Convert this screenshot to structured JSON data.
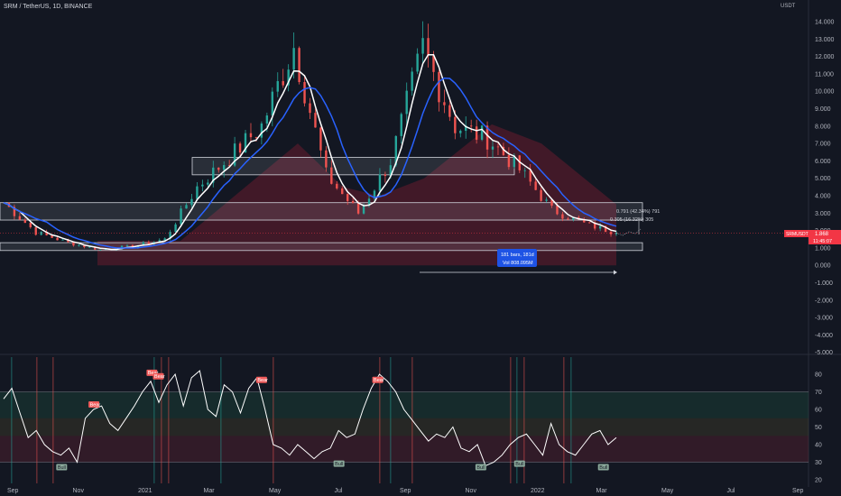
{
  "header": {
    "symbol_line": "SRM / TetherUS, 1D, BINANCE"
  },
  "colors": {
    "background": "#131722",
    "candle_up": "#26a69a",
    "candle_down": "#ef5350",
    "ma_fast": "#ffffff",
    "ma_slow": "#2962ff",
    "rsi_line": "#ffffff",
    "zone_box": "#d1d4dc",
    "label_bg": "#2962ff",
    "price_label_bg": "#f23645"
  },
  "chart_data": [
    {
      "type": "line",
      "title": "SRM / TetherUS, 1D, BINANCE",
      "currency": "USDT",
      "y_ticks": [
        "14.000",
        "13.000",
        "12.000",
        "11.000",
        "10.000",
        "9.000",
        "8.000",
        "7.000",
        "6.000",
        "5.000",
        "4.000",
        "3.000",
        "2.000",
        "1.000",
        "0.000",
        "-1.000",
        "-2.000",
        "-3.000",
        "-4.000",
        "-5.000"
      ],
      "ylim": [
        -5.3,
        14.3
      ],
      "x_ticks": [
        "Sep",
        "Nov",
        "2021",
        "Mar",
        "May",
        "Jul",
        "Sep",
        "Nov",
        "2022",
        "Mar",
        "May",
        "Jul",
        "Sep"
      ],
      "series": [
        {
          "name": "price",
          "x": [
            "2020-08",
            "2020-09",
            "2020-10",
            "2020-11",
            "2020-12",
            "2021-01",
            "2021-02",
            "2021-03",
            "2021-04",
            "2021-05",
            "2021-06",
            "2021-07",
            "2021-08",
            "2021-09",
            "2021-10",
            "2021-11",
            "2021-12",
            "2022-01",
            "2022-02",
            "2022-03"
          ],
          "values": [
            3.6,
            1.9,
            1.3,
            0.9,
            1.1,
            1.5,
            4.5,
            6.2,
            8.0,
            12.6,
            5.2,
            3.0,
            6.0,
            12.5,
            8.0,
            7.3,
            5.5,
            3.2,
            2.4,
            1.86
          ]
        }
      ],
      "zones": [
        {
          "from": 5.2,
          "to": 6.2
        },
        {
          "from": 2.6,
          "to": 3.6
        },
        {
          "from": 0.85,
          "to": 1.3
        }
      ],
      "annotations": {
        "measure_top": "0.791 (42.34%) 791",
        "measure_bottom": "0.305 (16.32%) 305",
        "range_bars": "181 bars, 181d",
        "range_vol": "Vol 808.095M",
        "symbol_tag": "SRMUSDT",
        "last_price": "1.868",
        "countdown": "11:45:07"
      }
    },
    {
      "type": "line",
      "title": "",
      "y_ticks": [
        "80",
        "70",
        "60",
        "50",
        "40",
        "30",
        "20"
      ],
      "ylim": [
        18,
        88
      ],
      "levels": [
        70,
        30
      ],
      "series": [
        {
          "name": "oscillator",
          "values": [
            66,
            72,
            58,
            44,
            48,
            40,
            36,
            34,
            38,
            30,
            55,
            60,
            62,
            52,
            48,
            55,
            62,
            70,
            76,
            64,
            74,
            80,
            62,
            78,
            82,
            60,
            56,
            74,
            70,
            58,
            72,
            78,
            60,
            40,
            38,
            34,
            40,
            36,
            32,
            36,
            38,
            48,
            44,
            46,
            60,
            72,
            80,
            76,
            70,
            60,
            54,
            48,
            42,
            46,
            44,
            50,
            38,
            36,
            40,
            28,
            30,
            34,
            40,
            44,
            46,
            40,
            34,
            52,
            40,
            36,
            34,
            40,
            46,
            48,
            40,
            44
          ]
        }
      ],
      "signals": [
        {
          "type": "Bull",
          "index": 9,
          "value": 30
        },
        {
          "type": "Bear",
          "index": 14,
          "value": 60
        },
        {
          "type": "Bear",
          "index": 23,
          "value": 78
        },
        {
          "type": "Bear",
          "index": 24,
          "value": 76
        },
        {
          "type": "Bear",
          "index": 40,
          "value": 74
        },
        {
          "type": "Bull",
          "index": 52,
          "value": 32
        },
        {
          "type": "Bear",
          "index": 58,
          "value": 74
        },
        {
          "type": "Bull",
          "index": 74,
          "value": 30
        },
        {
          "type": "Bull",
          "index": 80,
          "value": 32
        },
        {
          "type": "Bull",
          "index": 93,
          "value": 30
        }
      ]
    }
  ]
}
